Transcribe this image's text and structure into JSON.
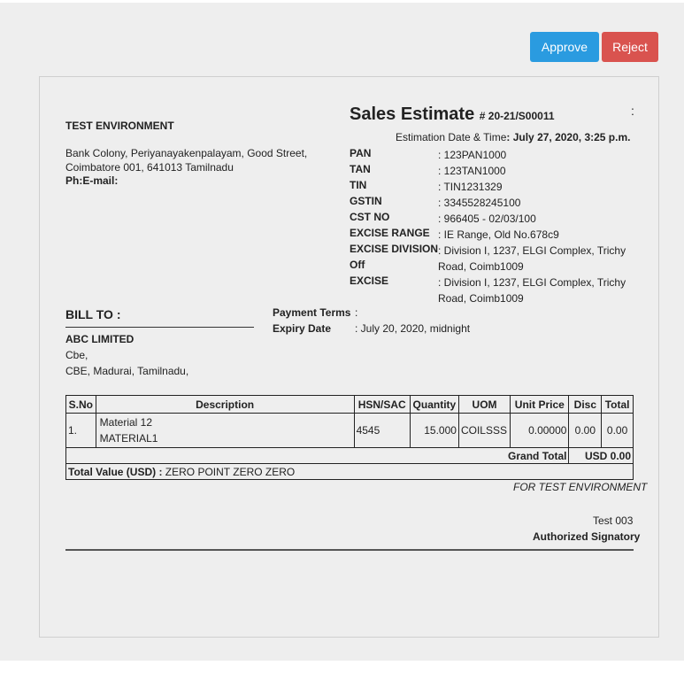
{
  "toolbar": {
    "approve_label": "Approve",
    "reject_label": "Reject",
    "colors": {
      "approve": "#2a9be0",
      "reject": "#d9534f"
    }
  },
  "company": {
    "name": "TEST ENVIRONMENT",
    "address_line1": "Bank Colony, Periyanayakenpalayam, Good Street,",
    "address_line2": "Coimbatore 001, 641013 Tamilnadu",
    "phone_email": "Ph:E-mail:"
  },
  "estimate": {
    "title": "Sales Estimate",
    "number": "# 20-21/S00011",
    "menu": ":",
    "date_label": "Estimation Date & Time",
    "date_value": ": July 27, 2020, 3:25 p.m."
  },
  "details": [
    {
      "key": "PAN",
      "value": ": 123PAN1000"
    },
    {
      "key": "TAN",
      "value": ": 123TAN1000"
    },
    {
      "key": "TIN",
      "value": ": TIN1231329"
    },
    {
      "key": "GSTIN",
      "value": ": 3345528245100"
    },
    {
      "key": "CST NO",
      "value": ": 966405 - 02/03/100"
    },
    {
      "key": "EXCISE RANGE",
      "value": ": IE Range, Old No.678c9"
    },
    {
      "key": "EXCISE DIVISION",
      "value": ": Division I, 1237, ELGI Complex, Trichy Road, Coimb1009"
    },
    {
      "key": "Off",
      "value": ""
    },
    {
      "key": "EXCISE",
      "value": ": Division I, 1237, ELGI Complex, Trichy Road, Coimb1009"
    }
  ],
  "bill_to": {
    "label": "BILL TO :",
    "name": "ABC LIMITED",
    "line1": "Cbe,",
    "line2": "CBE, Madurai, Tamilnadu,"
  },
  "terms": {
    "payment_label": "Payment Terms",
    "payment_value": ":",
    "expiry_label": "Expiry Date",
    "expiry_value": ": July 20, 2020, midnight"
  },
  "table": {
    "headers": [
      "S.No",
      "Description",
      "HSN/SAC",
      "Quantity",
      "UOM",
      "Unit Price",
      "Disc",
      "Total"
    ],
    "rows": [
      {
        "sno": "1.",
        "desc1": "Material 12",
        "desc2": "MATERIAL1",
        "hsn": "4545",
        "qty": "15.000",
        "uom": "COILSSS",
        "unit_price": "0.00000",
        "disc": "0.00",
        "total": "0.00"
      }
    ],
    "grand_total_label": "Grand Total",
    "grand_total_value": "USD 0.00",
    "total_value_label": "Total Value (USD) :",
    "total_value_words": "ZERO POINT ZERO ZERO"
  },
  "footer": {
    "for_company": "FOR TEST ENVIRONMENT",
    "signer": "Test 003",
    "authorized": "Authorized Signatory"
  }
}
